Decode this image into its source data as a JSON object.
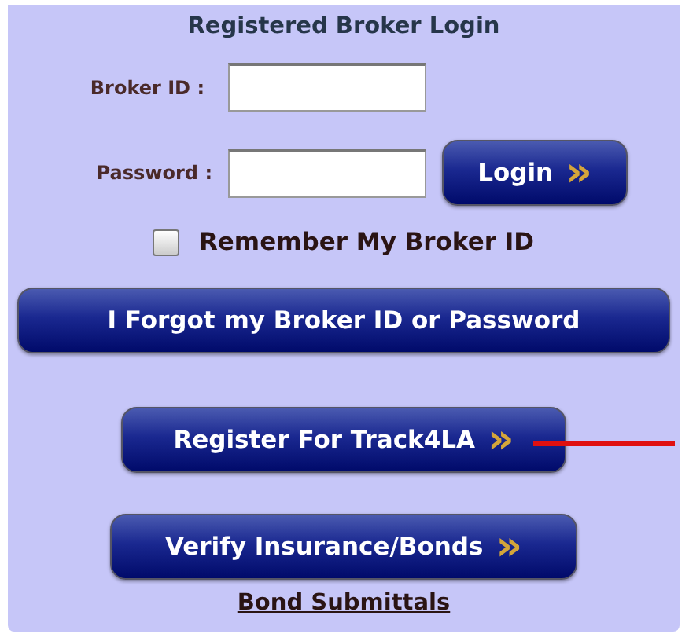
{
  "title": "Registered Broker Login",
  "fields": [
    {
      "label": "Broker ID :"
    },
    {
      "label": "Password :"
    }
  ],
  "login_button": {
    "label": "Login",
    "chevron": "»"
  },
  "remember": {
    "label": "Remember My Broker ID",
    "checked": false
  },
  "buttons": [
    {
      "label": "I Forgot my Broker ID or Password",
      "pointer": false
    },
    {
      "label": "Register For Track4LA",
      "chevron": "»",
      "pointer": true
    },
    {
      "label": "Verify Insurance/Bonds",
      "chevron": "»",
      "pointer": false
    }
  ],
  "link": "Bond Submittals"
}
